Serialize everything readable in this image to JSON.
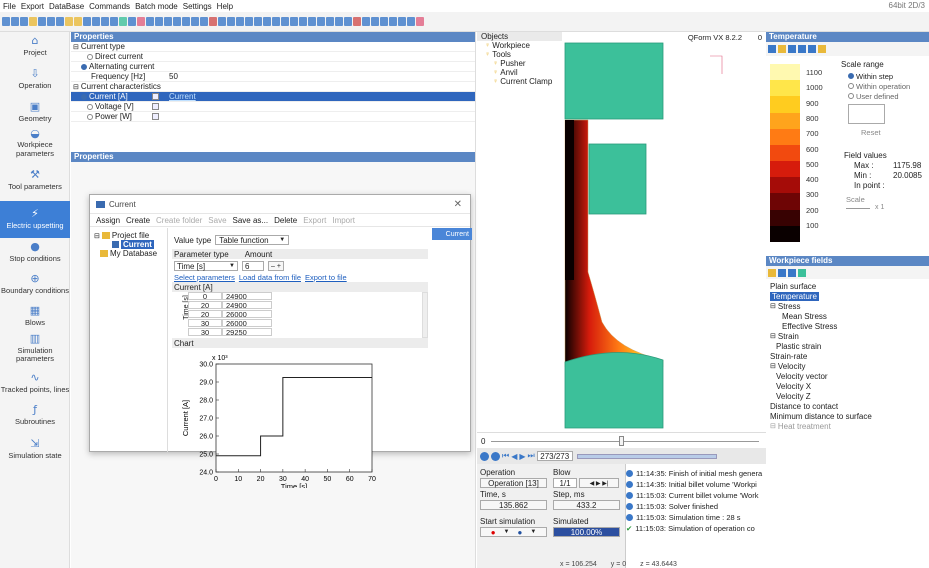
{
  "menu": [
    "File",
    "Export",
    "DataBase",
    "Commands",
    "Batch mode",
    "Settings",
    "Help"
  ],
  "window_title": "64bit 2D/3",
  "sidebar": {
    "items": [
      {
        "label": "Project",
        "icon": "project-icon"
      },
      {
        "label": "Operation",
        "icon": "operation-icon"
      },
      {
        "label": "Geometry",
        "icon": "geometry-icon"
      },
      {
        "label": "Workpiece parameters",
        "icon": "workpiece-icon"
      },
      {
        "label": "Tool parameters",
        "icon": "tool-icon"
      },
      {
        "label": "Electric upsetting",
        "icon": "electric-icon"
      },
      {
        "label": "Stop conditions",
        "icon": "stop-icon"
      },
      {
        "label": "Boundary conditions",
        "icon": "boundary-icon"
      },
      {
        "label": "Blows",
        "icon": "blows-icon"
      },
      {
        "label": "Simulation parameters",
        "icon": "simulation-icon"
      },
      {
        "label": "Tracked points, lines",
        "icon": "tracked-icon"
      },
      {
        "label": "Subroutines",
        "icon": "subroutines-icon"
      },
      {
        "label": "Simulation state",
        "icon": "state-icon"
      }
    ]
  },
  "properties": {
    "header": "Properties",
    "rows": [
      {
        "label": "Current type",
        "value": "",
        "indent": 0,
        "kind": "group"
      },
      {
        "label": "Direct current",
        "value": "",
        "indent": 2,
        "kind": "radio",
        "on": false
      },
      {
        "label": "Alternating current",
        "value": "",
        "indent": 1,
        "kind": "radio",
        "on": true
      },
      {
        "label": "Frequency [Hz]",
        "value": "50",
        "indent": 3,
        "kind": "text"
      },
      {
        "label": "Current characteristics",
        "value": "",
        "indent": 0,
        "kind": "group"
      },
      {
        "label": "Current [A]",
        "value": "Current",
        "indent": 1,
        "kind": "radio",
        "on": true,
        "selected": true
      },
      {
        "label": "Voltage [V]",
        "value": "",
        "indent": 2,
        "kind": "radio",
        "on": false
      },
      {
        "label": "Power [W]",
        "value": "",
        "indent": 2,
        "kind": "radio",
        "on": false
      }
    ],
    "header2": "Properties"
  },
  "dialog": {
    "title": "Current",
    "toolbar": [
      "Assign",
      "Create",
      "Create folder",
      "Save",
      "Save as...",
      "Delete",
      "Export",
      "Import"
    ],
    "tree": {
      "root": "Project file",
      "child": "Current",
      "db": "My Database"
    },
    "value_type_label": "Value type",
    "value_type": "Table function",
    "param_type_label": "Parameter type",
    "amount_label": "Amount",
    "param": "Time [s]",
    "amount": "6",
    "links": [
      "Select parameters",
      "Load data from file",
      "Export to file"
    ],
    "table_header": "Current [A]",
    "row_axis_label": "Time [s]",
    "rows": [
      [
        "0",
        "24900"
      ],
      [
        "20",
        "24900"
      ],
      [
        "20",
        "26000"
      ],
      [
        "30",
        "26000"
      ],
      [
        "30",
        "29250"
      ]
    ],
    "chart_label": "Chart",
    "right_tab": "Current"
  },
  "chart_data": {
    "type": "line",
    "step": true,
    "x": [
      0,
      20,
      20,
      30,
      30,
      70
    ],
    "y": [
      24.9,
      24.9,
      26.0,
      26.0,
      29.25,
      29.25
    ],
    "xlabel": "Time [s]",
    "ylabel": "Current [A]",
    "multiplier": "x 10³",
    "xticks": [
      0,
      10,
      20,
      30,
      40,
      50,
      60,
      70
    ],
    "yticks": [
      24.0,
      25.0,
      26.0,
      27.0,
      28.0,
      29.0,
      30.0
    ],
    "xlim": [
      0,
      70
    ],
    "ylim": [
      24.0,
      30.0
    ],
    "grid": true
  },
  "objects": {
    "header": "Objects",
    "items": [
      "Workpiece",
      "Tools",
      "Pusher",
      "Anvil",
      "Current Clamp"
    ]
  },
  "viewer": {
    "title": "QForm VX 8.2.2",
    "corner": "0",
    "step_value": "273/273",
    "slider_left": "0"
  },
  "temperature": {
    "header": "Temperature",
    "scale_title": "Scale range",
    "options": [
      "Within step",
      "Within operation",
      "User defined"
    ],
    "reset": "Reset",
    "ticks": [
      "1100",
      "1000",
      "900",
      "800",
      "700",
      "600",
      "500",
      "400",
      "300",
      "200",
      "100"
    ],
    "colors": [
      "#fff9b0",
      "#ffe64a",
      "#ffcc1f",
      "#ffa41c",
      "#ff7b14",
      "#f24a0f",
      "#d61c0c",
      "#a50c08",
      "#6e0505",
      "#380202",
      "#0a0000"
    ],
    "fv_title": "Field values",
    "max_label": "Max :",
    "max": "1175.98",
    "min_label": "Min :",
    "min": "20.0085",
    "inpoint_label": "In point :",
    "scale_label": "Scale",
    "scale_val": "x 1"
  },
  "fields": {
    "header": "Workpiece fields",
    "items": [
      {
        "label": "Plain surface",
        "indent": 0
      },
      {
        "label": "Temperature",
        "indent": 0,
        "selected": true
      },
      {
        "label": "Stress",
        "indent": 0
      },
      {
        "label": "Mean Stress",
        "indent": 2
      },
      {
        "label": "Effective Stress",
        "indent": 2
      },
      {
        "label": "Strain",
        "indent": 0
      },
      {
        "label": "Plastic strain",
        "indent": 1
      },
      {
        "label": "Strain-rate",
        "indent": 0
      },
      {
        "label": "Velocity",
        "indent": 0
      },
      {
        "label": "Velocity vector",
        "indent": 1
      },
      {
        "label": "Velocity X",
        "indent": 1
      },
      {
        "label": "Velocity Z",
        "indent": 1
      },
      {
        "label": "Distance to contact",
        "indent": 0
      },
      {
        "label": "Minimum distance to surface",
        "indent": 0
      },
      {
        "label": "Heat treatment",
        "indent": 0,
        "muted": true
      }
    ]
  },
  "control": {
    "operation_label": "Operation",
    "operation": "Operation [13]",
    "blow_label": "Blow",
    "blow": "1/1",
    "time_label": "Time, s",
    "time": "135.862",
    "step_label": "Step, ms",
    "step": "433.2",
    "start_label": "Start simulation",
    "simulated_label": "Simulated",
    "simulated": "100.00%",
    "simulated_fraction": 1.0
  },
  "log": [
    {
      "text": "11:14:35: Finish of initial mesh genera",
      "type": "info"
    },
    {
      "text": "11:14:35: Initial billet volume 'Workpi",
      "type": "info"
    },
    {
      "text": "11:15:03: Current billet volume 'Work",
      "type": "info"
    },
    {
      "text": "11:15:03: Solver finished",
      "type": "info"
    },
    {
      "text": "11:15:03: Simulation time : 28 s",
      "type": "info"
    },
    {
      "text": "11:15:03: Simulation of operation co",
      "type": "ok"
    }
  ],
  "status": {
    "x": "x = 106.254",
    "y": "y = 0",
    "z": "z = 43.6443"
  }
}
